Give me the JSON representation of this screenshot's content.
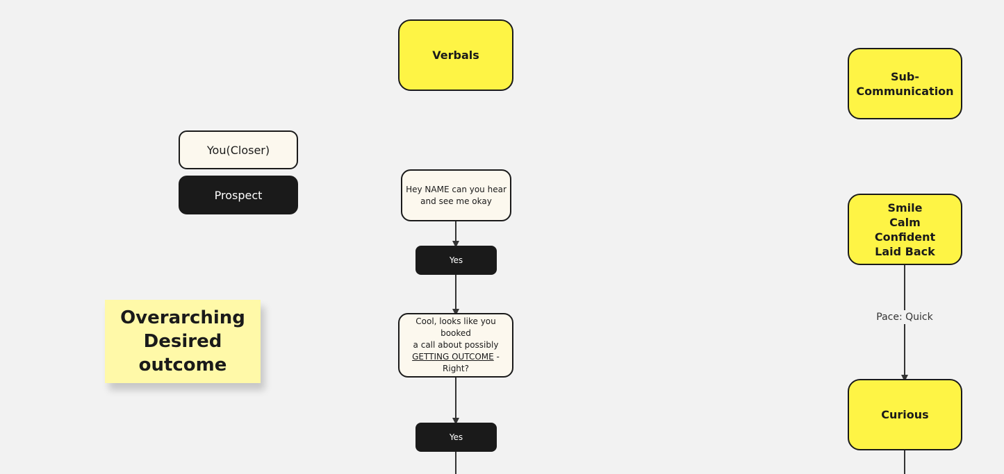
{
  "legend": {
    "closer_label": "You(Closer)",
    "prospect_label": "Prospect"
  },
  "sticky_note": {
    "text": "Overarching\nDesired\noutcome"
  },
  "verbals": {
    "header": "Verbals",
    "step1": "Hey NAME can you hear\nand see me okay",
    "reply1": "Yes",
    "step2_line1": "Cool, looks like you booked",
    "step2_line2": "a call about possibly",
    "step2_underlined": "GETTING OUTCOME",
    "step2_suffix": " - Right?",
    "reply2": "Yes"
  },
  "subcommunication": {
    "header": "Sub-\nCommunication",
    "traits": "Smile\nCalm\nConfident\nLaid Back",
    "edge_label": "Pace: Quick",
    "next": "Curious"
  },
  "colors": {
    "yellow": "#fef445",
    "cream": "#fcf8ee",
    "dark": "#1a1a1a",
    "sticky": "#fff9a8",
    "canvas": "#f2f2f2"
  }
}
